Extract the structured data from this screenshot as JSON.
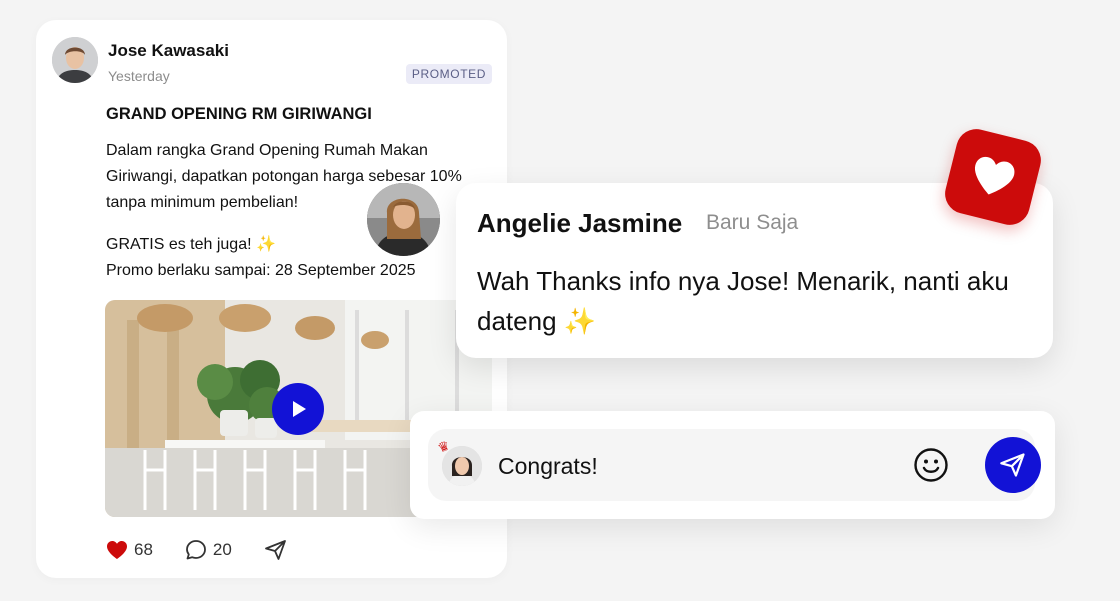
{
  "post": {
    "author": "Jose Kawasaki",
    "time": "Yesterday",
    "badge": "PROMOTED",
    "title": "GRAND OPENING RM GIRIWANGI",
    "body_1": "Dalam rangka Grand Opening Rumah Makan Giriwangi, dapatkan potongan harga sebesar 10% tanpa minimum pembelian!",
    "body_2": "GRATIS es teh juga!",
    "body_3": "Promo berlaku sampai: 28 September 2025",
    "likes": "68",
    "comments": "20"
  },
  "comment": {
    "author": "Angelie Jasmine",
    "time": "Baru Saja",
    "text": "Wah Thanks info nya Jose! Menarik, nanti aku dateng"
  },
  "composer": {
    "value": "Congrats!"
  },
  "icons": {
    "like": "heart-icon",
    "comment": "comment-icon",
    "share": "send-icon",
    "emoji": "smiley-icon",
    "send": "send-icon",
    "play": "play-icon",
    "reaction": "heart-icon",
    "sparkle": "sparkle-icon",
    "crown": "crown-icon"
  },
  "colors": {
    "accent": "#1212d6",
    "like": "#cc0b0b",
    "badge_bg": "#ebebf7",
    "badge_text": "#5b5f86"
  }
}
